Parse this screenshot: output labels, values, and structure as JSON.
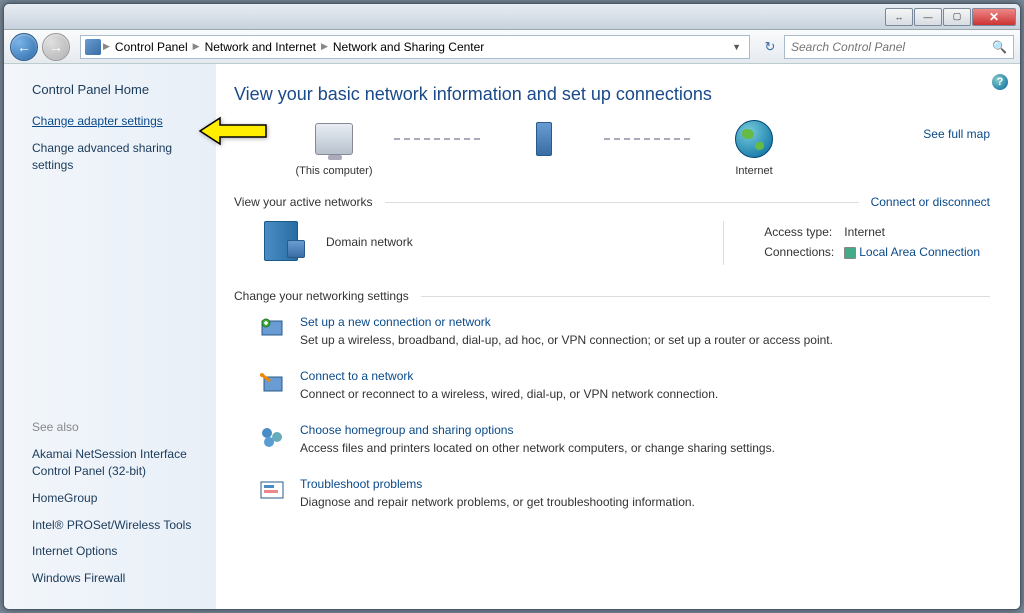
{
  "titlebar": {
    "unknown": "↔"
  },
  "nav": {
    "breadcrumb": [
      "Control Panel",
      "Network and Internet",
      "Network and Sharing Center"
    ],
    "search_placeholder": "Search Control Panel"
  },
  "sidebar": {
    "home": "Control Panel Home",
    "links": [
      {
        "label": "Change adapter settings",
        "highlighted": true
      },
      {
        "label": "Change advanced sharing settings",
        "highlighted": false
      }
    ],
    "see_also_label": "See also",
    "see_also": [
      "Akamai NetSession Interface Control Panel (32-bit)",
      "HomeGroup",
      "Intel® PROSet/Wireless Tools",
      "Internet Options",
      "Windows Firewall"
    ]
  },
  "main": {
    "heading": "View your basic network information and set up connections",
    "map": {
      "this_computer": "(This computer)",
      "internet": "Internet",
      "see_full_map": "See full map"
    },
    "active_header": "View your active networks",
    "connect_link": "Connect or disconnect",
    "active": {
      "name": "Domain network",
      "access_label": "Access type:",
      "access_value": "Internet",
      "conn_label": "Connections:",
      "conn_value": "Local Area Connection"
    },
    "change_header": "Change your networking settings",
    "tasks": [
      {
        "title": "Set up a new connection or network",
        "desc": "Set up a wireless, broadband, dial-up, ad hoc, or VPN connection; or set up a router or access point."
      },
      {
        "title": "Connect to a network",
        "desc": "Connect or reconnect to a wireless, wired, dial-up, or VPN network connection."
      },
      {
        "title": "Choose homegroup and sharing options",
        "desc": "Access files and printers located on other network computers, or change sharing settings."
      },
      {
        "title": "Troubleshoot problems",
        "desc": "Diagnose and repair network problems, or get troubleshooting information."
      }
    ]
  }
}
